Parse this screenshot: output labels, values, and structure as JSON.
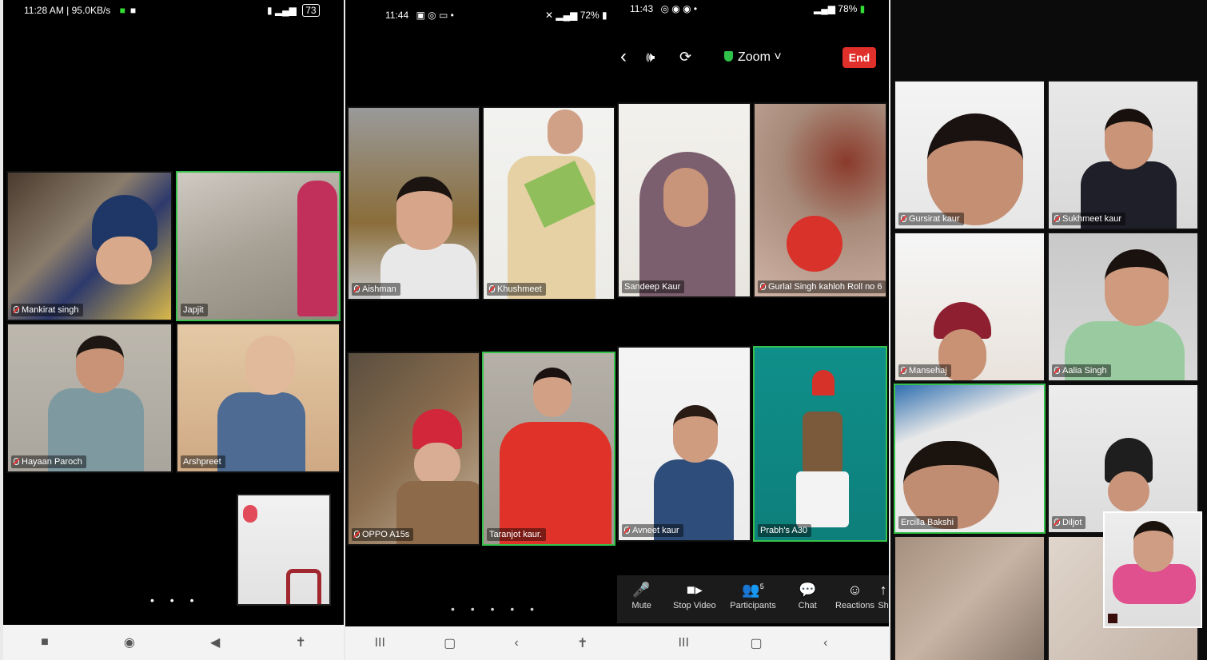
{
  "panel1": {
    "status_left": "11:28 AM | 95.0KB/s",
    "status_right": "73",
    "participants": [
      "Mankirat singh",
      "Japjit",
      "Hayaan Paroch",
      "Arshpreet"
    ],
    "dots": "• • •",
    "nav": [
      "■",
      "◉",
      "◀",
      "✝"
    ]
  },
  "panel2": {
    "status_left": "11:44",
    "status_right": "72%",
    "participants": [
      "Aishman",
      "Khushmeet",
      "OPPO A15s",
      "Taranjot  kaur."
    ],
    "dots": "• • • • •",
    "nav": [
      "III",
      "▢",
      "‹",
      "✝"
    ]
  },
  "panel3": {
    "status_left": "11:43",
    "status_right": "78%",
    "title": "Zoom",
    "end_label": "End",
    "participants": [
      "Sandeep Kaur",
      "Gurlal Singh kahloh Roll no 6",
      "Avneet kaur",
      "Prabh's A30"
    ],
    "controls": [
      {
        "label": "Mute",
        "icon": "microphone-icon"
      },
      {
        "label": "Stop Video",
        "icon": "video-camera-icon"
      },
      {
        "label": "Participants",
        "icon": "participants-icon"
      },
      {
        "label": "Chat",
        "icon": "chat-icon"
      },
      {
        "label": "Reactions",
        "icon": "reactions-icon"
      },
      {
        "label": "Sh",
        "icon": "share-icon"
      }
    ],
    "participants_count": "5",
    "nav": [
      "III",
      "▢",
      "‹"
    ]
  },
  "panel4": {
    "participants": [
      "Gursirat kaur",
      "Sukhmeet kaur",
      "Mansehaj",
      "Aalia Singh",
      "Ercilla Bakshi",
      "Diljot"
    ]
  },
  "colors": {
    "active_border": "#36c24a",
    "end_button": "#e0302b",
    "background": "#000000"
  }
}
